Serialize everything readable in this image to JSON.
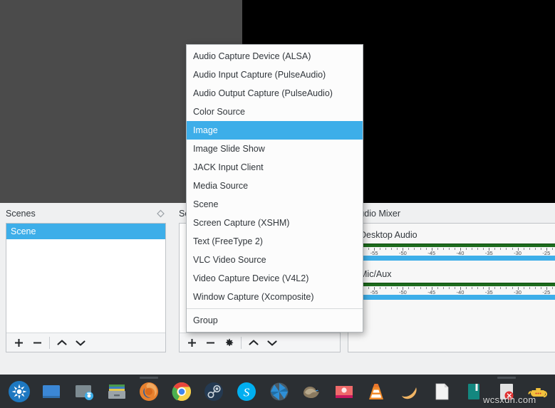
{
  "preview": {
    "name": "obs-preview-canvas"
  },
  "scenes_dock": {
    "title": "Scenes",
    "float_icon": "float-diamond-icon",
    "items": [
      {
        "label": "Scene",
        "selected": true
      }
    ],
    "toolbar": {
      "add_label": "+",
      "remove_label": "−",
      "up_label": "⌃",
      "down_label": "⌄"
    }
  },
  "sources_dock": {
    "title": "Sources",
    "items": [],
    "toolbar": {
      "add_label": "+",
      "remove_label": "−",
      "properties_label": "gear",
      "up_label": "⌃",
      "down_label": "⌄"
    }
  },
  "mixer_dock": {
    "title": "Audio Mixer",
    "channels": [
      {
        "name": "Desktop Audio",
        "meter_color": "#1d6b1d",
        "slider_color": "#3daee9",
        "scale_labels": [
          "-55",
          "-50",
          "-45",
          "-40",
          "-35",
          "-30",
          "-25"
        ]
      },
      {
        "name": "Mic/Aux",
        "meter_color": "#1d6b1d",
        "slider_color": "#3daee9",
        "scale_labels": [
          "-55",
          "-50",
          "-45",
          "-40",
          "-35",
          "-30",
          "-25"
        ]
      }
    ]
  },
  "add_source_menu": {
    "items": [
      {
        "label": "Audio Capture Device (ALSA)",
        "selected": false
      },
      {
        "label": "Audio Input Capture (PulseAudio)",
        "selected": false
      },
      {
        "label": "Audio Output Capture (PulseAudio)",
        "selected": false
      },
      {
        "label": "Color Source",
        "selected": false
      },
      {
        "label": "Image",
        "selected": true
      },
      {
        "label": "Image Slide Show",
        "selected": false
      },
      {
        "label": "JACK Input Client",
        "selected": false
      },
      {
        "label": "Media Source",
        "selected": false
      },
      {
        "label": "Scene",
        "selected": false
      },
      {
        "label": "Screen Capture (XSHM)",
        "selected": false
      },
      {
        "label": "Text (FreeType 2)",
        "selected": false
      },
      {
        "label": "VLC Video Source",
        "selected": false
      },
      {
        "label": "Video Capture Device (V4L2)",
        "selected": false
      },
      {
        "label": "Window Capture (Xcomposite)",
        "selected": false
      }
    ],
    "group_label": "Group"
  },
  "taskbar": {
    "icons": [
      {
        "name": "kubuntu-menu-icon",
        "running": false
      },
      {
        "name": "file-manager-icon",
        "running": false
      },
      {
        "name": "screenshot-tool-icon",
        "running": false
      },
      {
        "name": "archive-manager-icon",
        "running": false
      },
      {
        "name": "firefox-icon",
        "running": true
      },
      {
        "name": "chrome-icon",
        "running": false
      },
      {
        "name": "steam-icon",
        "running": false
      },
      {
        "name": "skype-icon",
        "running": false
      },
      {
        "name": "shutter-icon",
        "running": false
      },
      {
        "name": "thunderbird-icon",
        "running": false
      },
      {
        "name": "image-viewer-icon",
        "running": false
      },
      {
        "name": "vlc-icon",
        "running": false
      },
      {
        "name": "mango-icon",
        "running": false
      },
      {
        "name": "text-editor-icon",
        "running": false
      },
      {
        "name": "book-reader-icon",
        "running": false
      },
      {
        "name": "obs-studio-icon",
        "running": true
      },
      {
        "name": "teapot-icon",
        "running": false
      }
    ]
  },
  "watermark": {
    "text": "wcsxdn.com"
  },
  "colors": {
    "accent": "#3daee9",
    "panel_bg": "#eff0f1",
    "meter_green": "#1d6b1d",
    "taskbar_bg": "#2b2f33",
    "preview_gray": "#4b4b4b"
  }
}
